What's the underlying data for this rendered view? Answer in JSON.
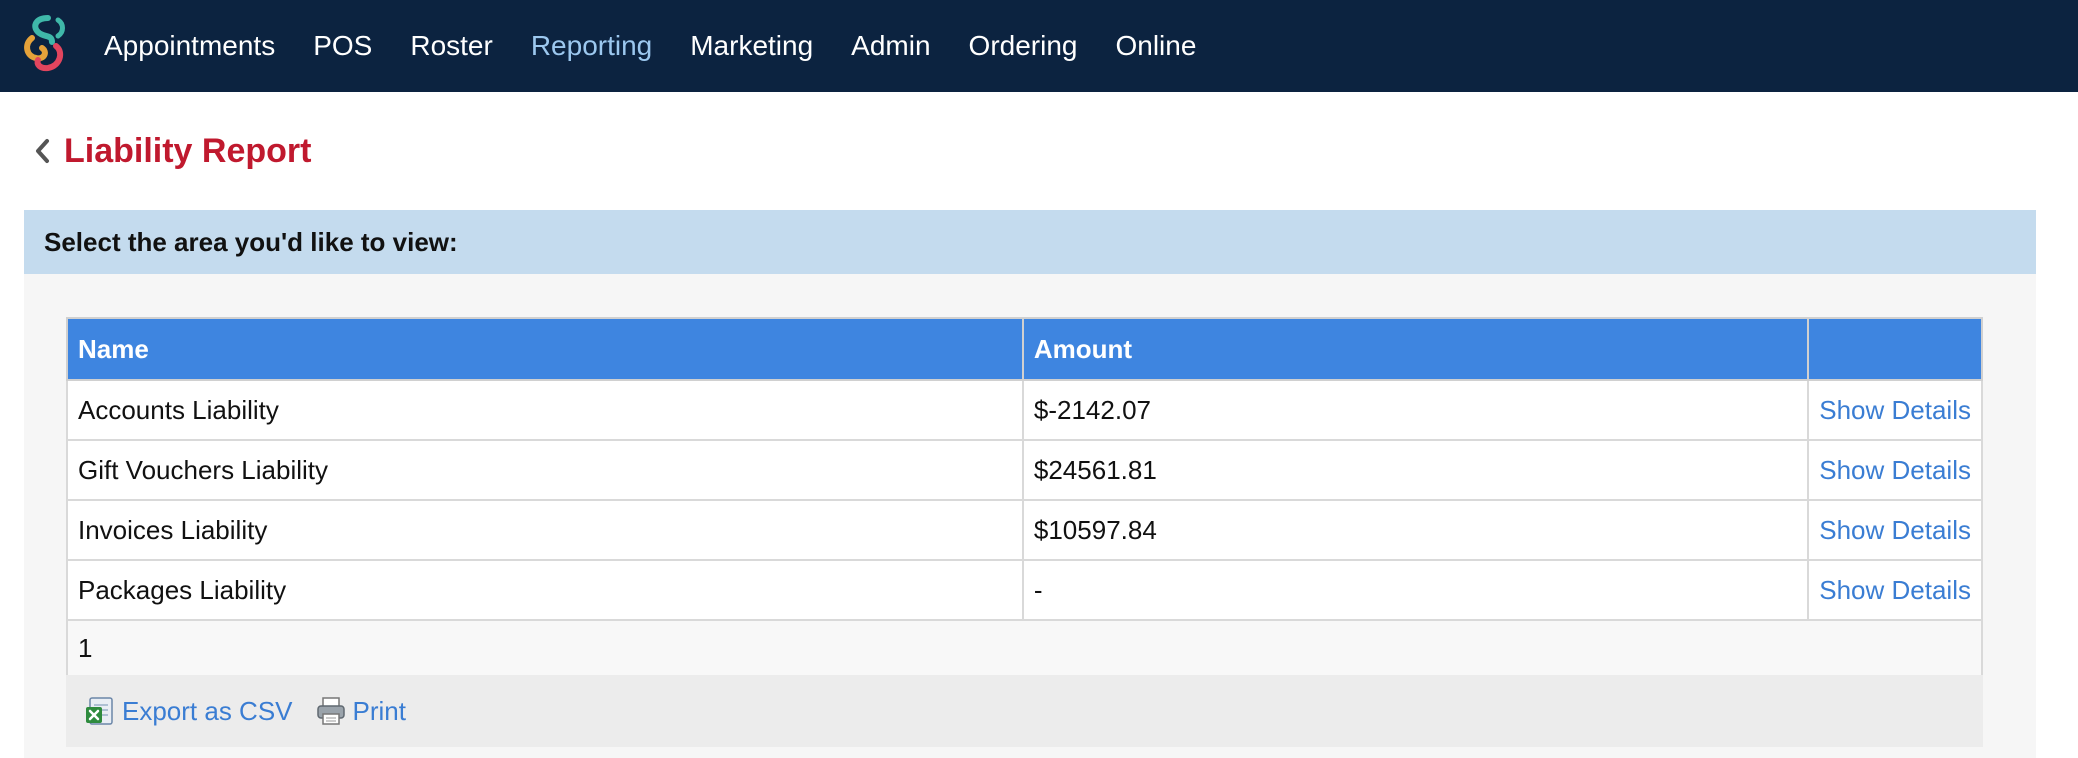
{
  "nav": {
    "items": [
      {
        "label": "Appointments",
        "active": false
      },
      {
        "label": "POS",
        "active": false
      },
      {
        "label": "Roster",
        "active": false
      },
      {
        "label": "Reporting",
        "active": true
      },
      {
        "label": "Marketing",
        "active": false
      },
      {
        "label": "Admin",
        "active": false
      },
      {
        "label": "Ordering",
        "active": false
      },
      {
        "label": "Online",
        "active": false
      }
    ]
  },
  "page": {
    "title": "Liability Report"
  },
  "section": {
    "heading": "Select the area you'd like to view:"
  },
  "table": {
    "headers": {
      "name": "Name",
      "amount": "Amount",
      "action": ""
    },
    "rows": [
      {
        "name": "Accounts Liability",
        "amount": "$-2142.07",
        "action": "Show Details"
      },
      {
        "name": "Gift Vouchers Liability",
        "amount": "$24561.81",
        "action": "Show Details"
      },
      {
        "name": "Invoices Liability",
        "amount": "$10597.84",
        "action": "Show Details"
      },
      {
        "name": "Packages Liability",
        "amount": "-",
        "action": "Show Details"
      }
    ],
    "page_number": "1"
  },
  "actions": {
    "export_label": "Export as CSV",
    "print_label": "Print"
  },
  "colors": {
    "nav_bg": "#0c2340",
    "title": "#c0192e",
    "section_header_bg": "#c4dbee",
    "table_header_bg": "#3e85e0",
    "link": "#3a7dd3"
  }
}
